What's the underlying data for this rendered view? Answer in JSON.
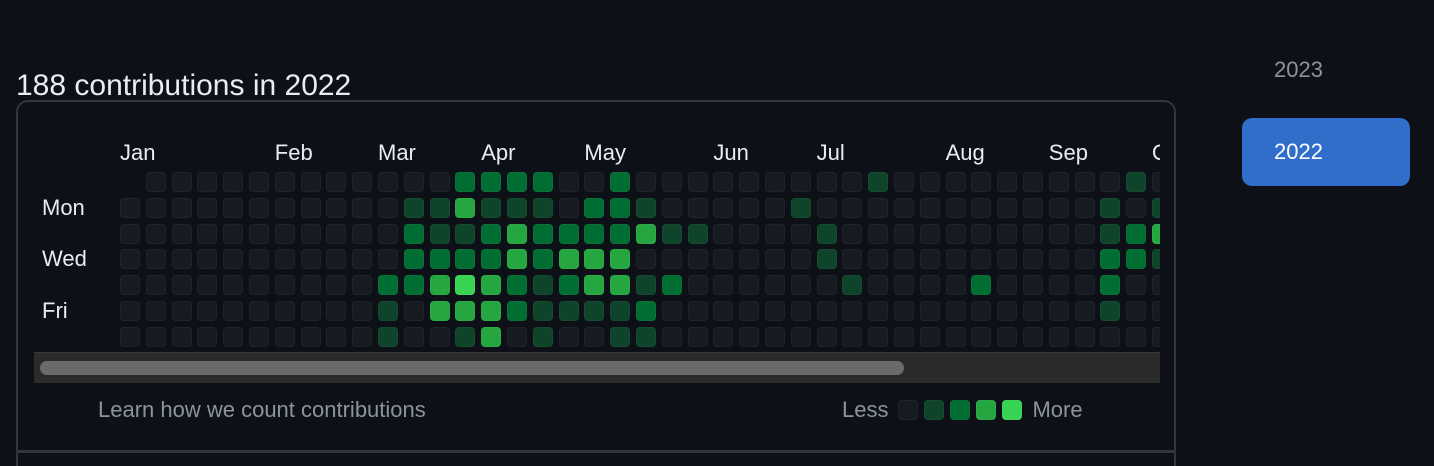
{
  "heading": "188 contributions in 2022",
  "months": [
    {
      "label": "Jan",
      "col": 0
    },
    {
      "label": "Feb",
      "col": 6
    },
    {
      "label": "Mar",
      "col": 10
    },
    {
      "label": "Apr",
      "col": 14
    },
    {
      "label": "May",
      "col": 18
    },
    {
      "label": "Jun",
      "col": 23
    },
    {
      "label": "Jul",
      "col": 27
    },
    {
      "label": "Aug",
      "col": 32
    },
    {
      "label": "Sep",
      "col": 36
    },
    {
      "label": "O",
      "col": 40
    }
  ],
  "day_labels": [
    {
      "label": "Mon",
      "row": 1
    },
    {
      "label": "Wed",
      "row": 3
    },
    {
      "label": "Fri",
      "row": 5
    }
  ],
  "level_colors": [
    "#161b22",
    "#0e4429",
    "#006d32",
    "#26a641",
    "#39d353"
  ],
  "grid_levels": [
    "x00000000000022220020000000001000000000100000",
    "000000000001131110221000001000000000001011000",
    "000000000002112322223110000100000000001233100",
    "000000000002222323330000000100000000002210000",
    "000000000022343212331200000010000200002000100",
    "000000000010333211112000000000000000001000000",
    "000000000010013010011000000000000000000000000"
  ],
  "learn_link": "Learn how we count contributions",
  "legend": {
    "less": "Less",
    "more": "More"
  },
  "years": [
    {
      "label": "2023",
      "selected": false
    },
    {
      "label": "2022",
      "selected": true
    }
  ]
}
